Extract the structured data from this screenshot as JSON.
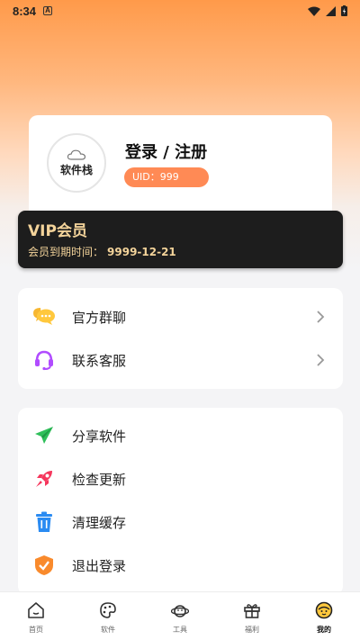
{
  "status_bar": {
    "time": "8:34",
    "badge": "A"
  },
  "profile": {
    "avatar_text": "软件栈",
    "login_title": "登录 / 注册",
    "uid": "UID：999"
  },
  "vip": {
    "title": "VIP会员",
    "expire_label": "会员到期时间：",
    "expire_date": "9999-12-21"
  },
  "menu_group_1": [
    {
      "label": "官方群聊",
      "icon": "chat-bubble-icon"
    },
    {
      "label": "联系客服",
      "icon": "headset-icon"
    }
  ],
  "menu_group_2": [
    {
      "label": "分享软件",
      "icon": "send-icon"
    },
    {
      "label": "检查更新",
      "icon": "rocket-icon"
    },
    {
      "label": "清理缓存",
      "icon": "trash-icon"
    },
    {
      "label": "退出登录",
      "icon": "shield-check-icon"
    }
  ],
  "tabs": [
    {
      "label": "首页",
      "icon": "home-icon"
    },
    {
      "label": "软件",
      "icon": "palette-icon"
    },
    {
      "label": "工具",
      "icon": "planet-icon"
    },
    {
      "label": "福利",
      "icon": "gift-icon"
    },
    {
      "label": "我的",
      "icon": "face-icon",
      "active": true
    }
  ],
  "colors": {
    "accent": "#ff8a55",
    "vip_bg": "#1d1d1d",
    "vip_text": "#f3d39a"
  }
}
